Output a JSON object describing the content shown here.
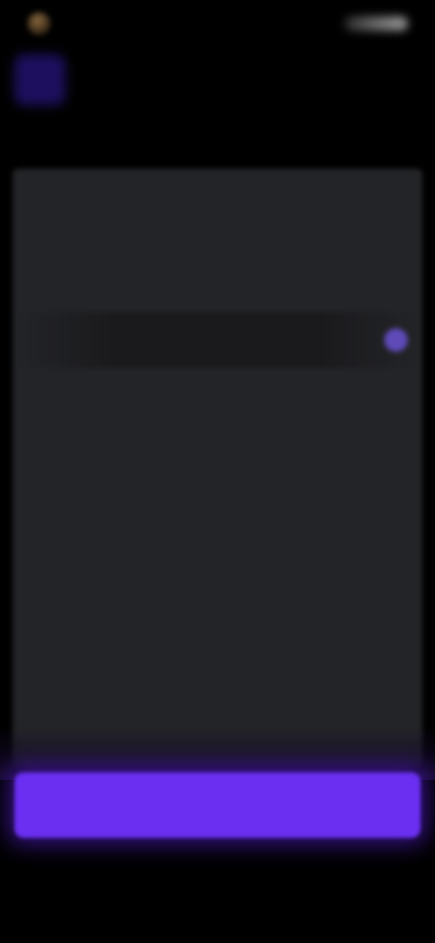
{
  "status_bar": {
    "time": "",
    "icons": [
      "avatar-icon",
      "signal-icon",
      "battery-icon"
    ]
  },
  "header": {
    "title": "",
    "subtitle": "",
    "brand_color": "#1d0f5e"
  },
  "instruction": "",
  "options": [
    {
      "label": "",
      "selected": false
    },
    {
      "label": "",
      "selected": false
    },
    {
      "label": "",
      "selected": true
    },
    {
      "label": "",
      "selected": false
    },
    {
      "label": "",
      "selected": false
    },
    {
      "label": "",
      "selected": false
    },
    {
      "label": "",
      "selected": false
    },
    {
      "label": "",
      "selected": false
    },
    {
      "label": "",
      "selected": false
    }
  ],
  "continue_button": {
    "label": "",
    "color": "#6a2ff0"
  },
  "colors": {
    "background": "#000000",
    "card": "#232427",
    "accent": "#5f3df0"
  }
}
